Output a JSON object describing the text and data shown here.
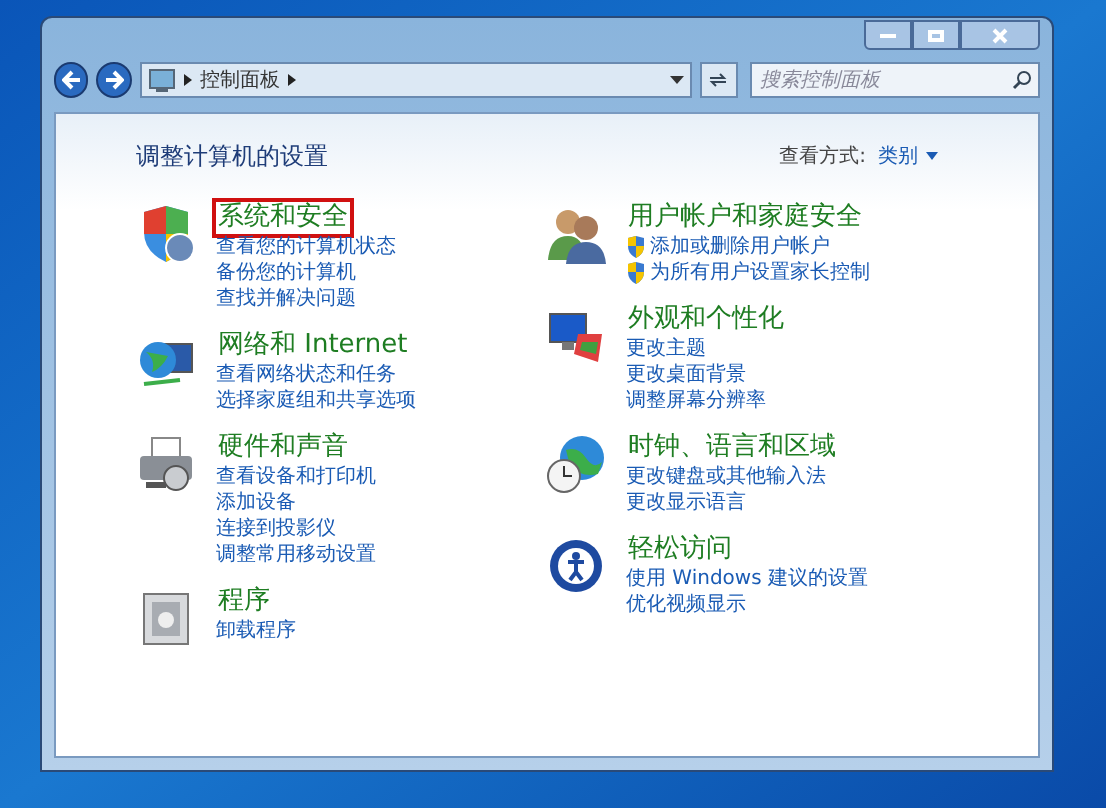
{
  "address_bar": {
    "breadcrumb": "控制面板"
  },
  "search": {
    "placeholder": "搜索控制面板"
  },
  "page_title": "调整计算机的设置",
  "view_by": {
    "label": "查看方式:",
    "value": "类别"
  },
  "columns": [
    [
      {
        "title": "系统和安全",
        "highlighted": true,
        "links": [
          {
            "text": "查看您的计算机状态",
            "shield": false
          },
          {
            "text": "备份您的计算机",
            "shield": false
          },
          {
            "text": "查找并解决问题",
            "shield": false
          }
        ]
      },
      {
        "title": "网络和 Internet",
        "highlighted": false,
        "links": [
          {
            "text": "查看网络状态和任务",
            "shield": false
          },
          {
            "text": "选择家庭组和共享选项",
            "shield": false
          }
        ]
      },
      {
        "title": "硬件和声音",
        "highlighted": false,
        "links": [
          {
            "text": "查看设备和打印机",
            "shield": false
          },
          {
            "text": "添加设备",
            "shield": false
          },
          {
            "text": "连接到投影仪",
            "shield": false
          },
          {
            "text": "调整常用移动设置",
            "shield": false
          }
        ]
      },
      {
        "title": "程序",
        "highlighted": false,
        "links": [
          {
            "text": "卸载程序",
            "shield": false
          }
        ]
      }
    ],
    [
      {
        "title": "用户帐户和家庭安全",
        "highlighted": false,
        "links": [
          {
            "text": "添加或删除用户帐户",
            "shield": true
          },
          {
            "text": "为所有用户设置家长控制",
            "shield": true
          }
        ]
      },
      {
        "title": "外观和个性化",
        "highlighted": false,
        "links": [
          {
            "text": "更改主题",
            "shield": false
          },
          {
            "text": "更改桌面背景",
            "shield": false
          },
          {
            "text": "调整屏幕分辨率",
            "shield": false
          }
        ]
      },
      {
        "title": "时钟、语言和区域",
        "highlighted": false,
        "links": [
          {
            "text": "更改键盘或其他输入法",
            "shield": false
          },
          {
            "text": "更改显示语言",
            "shield": false
          }
        ]
      },
      {
        "title": "轻松访问",
        "highlighted": false,
        "links": [
          {
            "text": "使用 Windows 建议的设置",
            "shield": false
          },
          {
            "text": "优化视频显示",
            "shield": false
          }
        ]
      }
    ]
  ]
}
